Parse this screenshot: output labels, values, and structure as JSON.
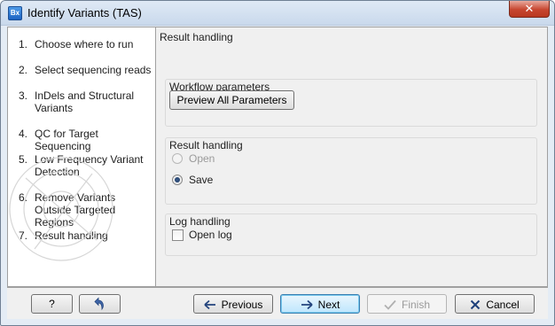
{
  "window": {
    "title": "Identify Variants (TAS)",
    "app_icon_text": "Bx",
    "close_glyph": "✕"
  },
  "steps": [
    {
      "num": "1.",
      "label": "Choose where to run"
    },
    {
      "num": "2.",
      "label": "Select sequencing reads"
    },
    {
      "num": "3.",
      "label": "InDels and Structural Variants"
    },
    {
      "num": "4.",
      "label": "QC for Target Sequencing"
    },
    {
      "num": "5.",
      "label": "Low Frequency Variant Detection"
    },
    {
      "num": "6.",
      "label": "Remove Variants Outside Targeted Regions"
    },
    {
      "num": "7.",
      "label": "Result handling"
    }
  ],
  "content": {
    "title": "Result handling",
    "workflow_group": {
      "title": "Workflow parameters",
      "preview_button": "Preview All Parameters"
    },
    "result_group": {
      "title": "Result handling",
      "open_label": "Open",
      "save_label": "Save",
      "selected": "Save"
    },
    "log_group": {
      "title": "Log handling",
      "open_log_label": "Open log",
      "open_log_checked": false
    }
  },
  "footer": {
    "help_label": "?",
    "reset_icon": "undo-arrow-icon",
    "previous_label": "Previous",
    "next_label": "Next",
    "finish_label": "Finish",
    "cancel_label": "Cancel"
  },
  "colors": {
    "titlebar": "#c9d9ec",
    "close_button": "#c7462f",
    "default_button_border": "#3c7fb1",
    "cancel_x": "#1d3f7a",
    "arrow": "#23447d"
  }
}
